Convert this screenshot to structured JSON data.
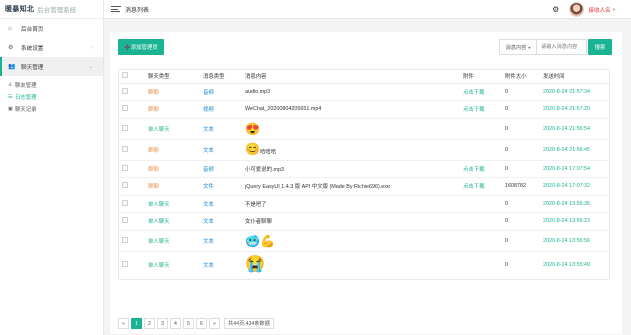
{
  "app": {
    "brand": "暖暴知北",
    "system": "后台管理系统"
  },
  "sidebar": {
    "items": [
      {
        "icon": "home-icon",
        "glyph": "⌂",
        "label": "后台首页"
      },
      {
        "icon": "gear-icon",
        "glyph": "⚙",
        "label": "系统设置",
        "chevron": "‹"
      },
      {
        "icon": "users-icon",
        "glyph": "👥",
        "label": "聊天管理",
        "chevron": "⌄"
      }
    ],
    "subitems": [
      {
        "icon": "user-icon",
        "glyph": "♙",
        "label": "聊友管理"
      },
      {
        "icon": "list-icon",
        "glyph": "☰",
        "label": "日志管理"
      },
      {
        "icon": "chat-icon",
        "glyph": "▣",
        "label": "聊天记录"
      }
    ]
  },
  "topbar": {
    "page_title": "消息列表",
    "username": "接收人名",
    "chevron": "▾"
  },
  "toolbar": {
    "add_label": "➕添加管理员",
    "select_label": "消息内容",
    "select_caret": "▾",
    "search_placeholder": "请输入消息内容",
    "search_button": "搜索"
  },
  "table": {
    "headers": [
      "聊天类型",
      "消息类型",
      "消息内容",
      "附件",
      "附件大小",
      "发送时间"
    ],
    "rows": [
      {
        "chat_type": "群聊",
        "chat_color": "red",
        "msg_type": "音频",
        "content": "audio.mp3",
        "kind": "text",
        "attach": "点击下载",
        "size": "0",
        "time": "2020-8-24 21:57:34"
      },
      {
        "chat_type": "群聊",
        "chat_color": "red",
        "msg_type": "视频",
        "content": "WeChat_20200804205651.mp4",
        "kind": "text",
        "attach": "点击下载",
        "size": "0",
        "time": "2020-8-24 21:57:20"
      },
      {
        "chat_type": "单人聊天",
        "chat_color": "green",
        "msg_type": "文本",
        "content": "😍",
        "kind": "emoji",
        "attach": "",
        "size": "0",
        "time": "2020-8-24 21:56:54"
      },
      {
        "chat_type": "群聊",
        "chat_color": "red",
        "msg_type": "文本",
        "content": "😊",
        "suffix": "哈哈哈",
        "kind": "emoji",
        "attach": "",
        "size": "0",
        "time": "2020-8-24 21:56:45"
      },
      {
        "chat_type": "群聊",
        "chat_color": "red",
        "msg_type": "音频",
        "content": "小可爱说的.mp3",
        "kind": "text",
        "attach": "点击下载",
        "size": "0",
        "time": "2020-8-24 17:07:54"
      },
      {
        "chat_type": "群聊",
        "chat_color": "red",
        "msg_type": "文件",
        "content": "jQuery EasyUI 1.4.3 版 API 中文版 (Made By Richie696).exe",
        "kind": "text",
        "attach": "点击下载",
        "size": "1608782",
        "time": "2020-8-24 17:07:32"
      },
      {
        "chat_type": "单人聊天",
        "chat_color": "green",
        "msg_type": "文本",
        "content": "不是吧了",
        "kind": "text",
        "attach": "",
        "size": "0",
        "time": "2020-8-24 13:56:35"
      },
      {
        "chat_type": "单人聊天",
        "chat_color": "green",
        "msg_type": "文本",
        "content": "女仆者聊聊",
        "kind": "text",
        "attach": "",
        "size": "0",
        "time": "2020-8-24 13:56:23"
      },
      {
        "chat_type": "单人聊天",
        "chat_color": "green",
        "msg_type": "文本",
        "content": "🥶💪",
        "kind": "emoji",
        "attach": "",
        "size": "0",
        "time": "2020-8-24 13:56:56"
      },
      {
        "chat_type": "单人聊天",
        "chat_color": "green",
        "msg_type": "文本",
        "content": "😭",
        "kind": "emoji-big",
        "attach": "",
        "size": "0",
        "time": "2020-8-24 13:55:49"
      }
    ]
  },
  "pagination": {
    "prev": "«",
    "pages": [
      "1",
      "2",
      "3",
      "4",
      "5",
      "6"
    ],
    "current": "1",
    "next": "»",
    "info": "共44页,434条数据"
  },
  "colors": {
    "accent": "#1ab394",
    "orange": "#e8944a",
    "blue": "#1c84c6"
  }
}
